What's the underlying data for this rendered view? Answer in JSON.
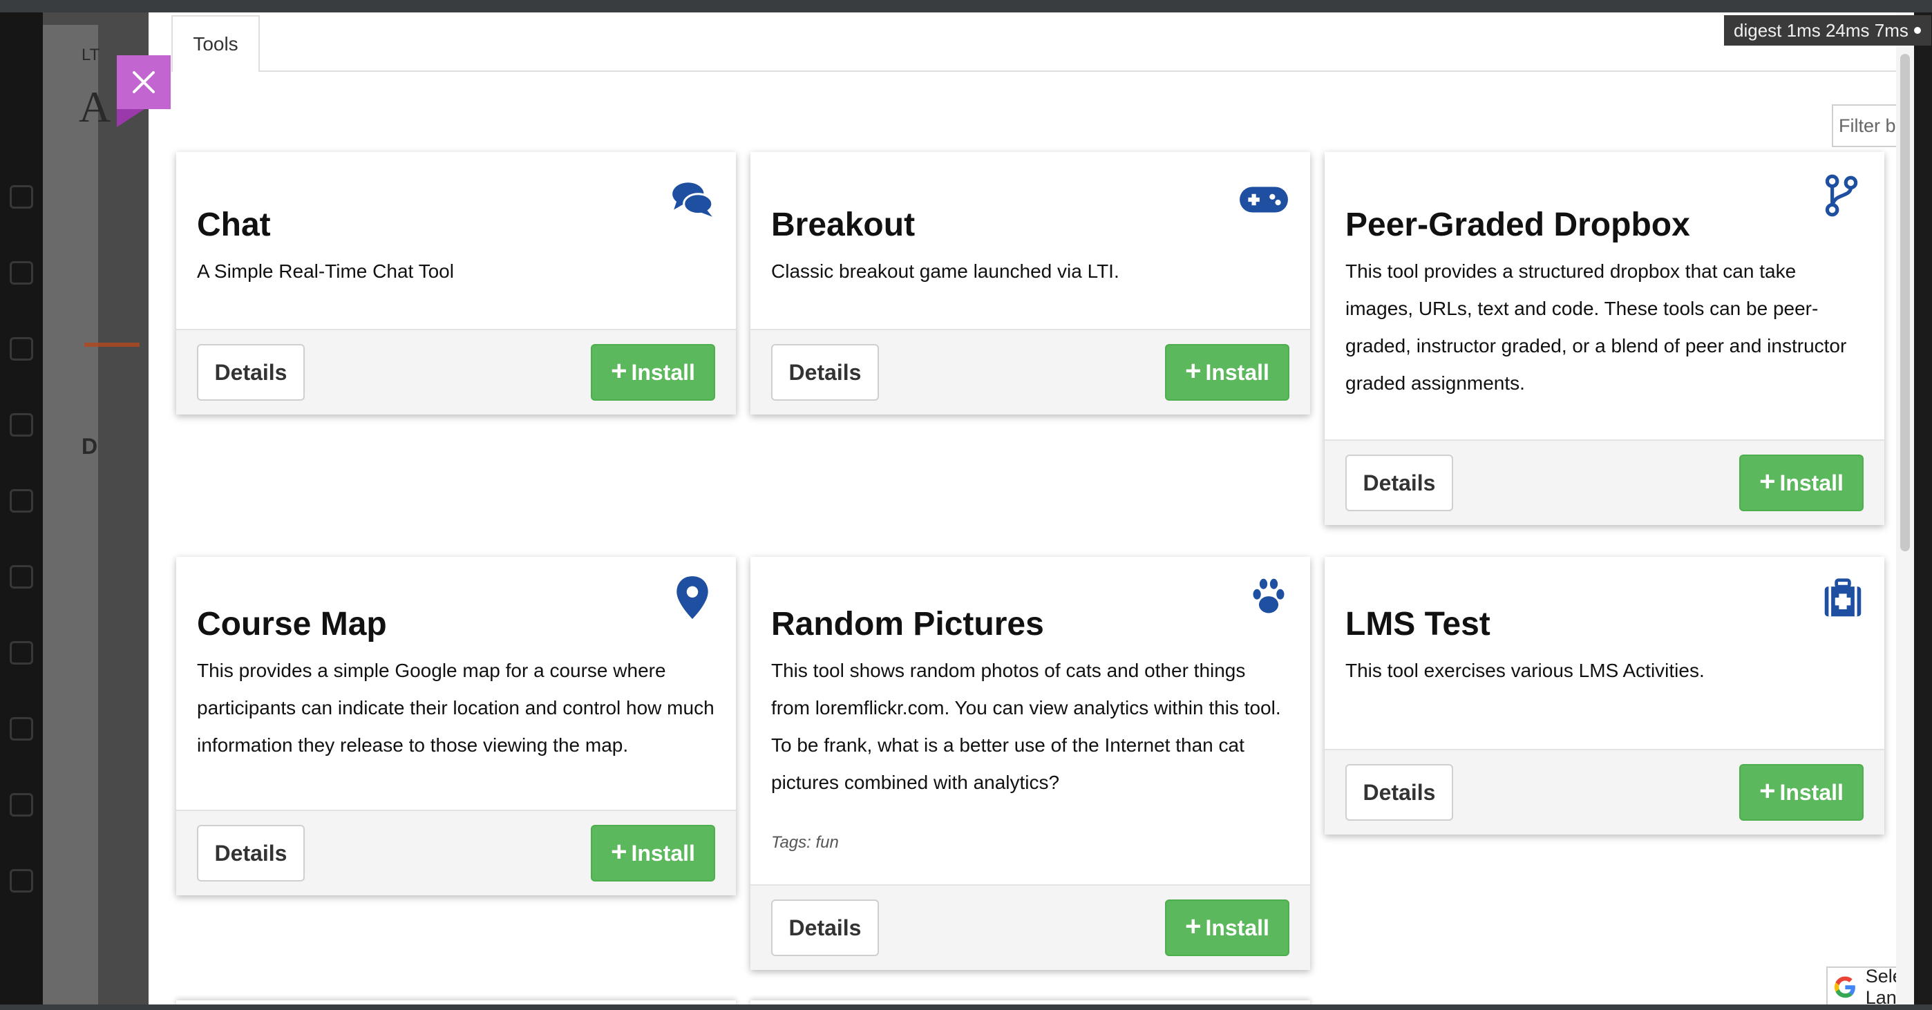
{
  "modal": {
    "tab_label": "Tools",
    "digest_text": "digest 1ms 24ms 7ms",
    "filter_placeholder": "Filter by keyword",
    "language_selector_label": "Select Language",
    "language_selector_arrow": "▼"
  },
  "background_app": {
    "partial_label": "LT",
    "partial_heading": "A",
    "partial_section": "D"
  },
  "tools": [
    {
      "title": "Chat",
      "description": "A Simple Real-Time Chat Tool",
      "tags": "",
      "icon": "chat-icon",
      "details_label": "Details",
      "install_label": "Install"
    },
    {
      "title": "Breakout",
      "description": "Classic breakout game launched via LTI.",
      "tags": "",
      "icon": "gamepad-icon",
      "details_label": "Details",
      "install_label": "Install"
    },
    {
      "title": "Peer-Graded Dropbox",
      "description": "This tool provides a structured dropbox that can take images, URLs, text and code. These tools can be peer-graded, instructor graded, or a blend of peer and instructor graded assignments.",
      "tags": "",
      "icon": "branch-icon",
      "details_label": "Details",
      "install_label": "Install"
    },
    {
      "title": "Course Map",
      "description": "This provides a simple Google map for a course where participants can indicate their location and control how much information they release to those viewing the map.",
      "tags": "",
      "icon": "map-marker-icon",
      "details_label": "Details",
      "install_label": "Install"
    },
    {
      "title": "Random Pictures",
      "description": "This tool shows random photos of cats and other things from loremflickr.com. You can view analytics within this tool. To be frank, what is a better use of the Internet than cat pictures combined with analytics?",
      "tags": "Tags: fun",
      "icon": "paw-icon",
      "details_label": "Details",
      "install_label": "Install"
    },
    {
      "title": "LMS Test",
      "description": "This tool exercises various LMS Activities.",
      "tags": "",
      "icon": "medkit-icon",
      "details_label": "Details",
      "install_label": "Install"
    }
  ],
  "colors": {
    "accent_purple": "#c265d0",
    "install_green": "#5cb85c",
    "icon_blue": "#1e4fa0"
  }
}
